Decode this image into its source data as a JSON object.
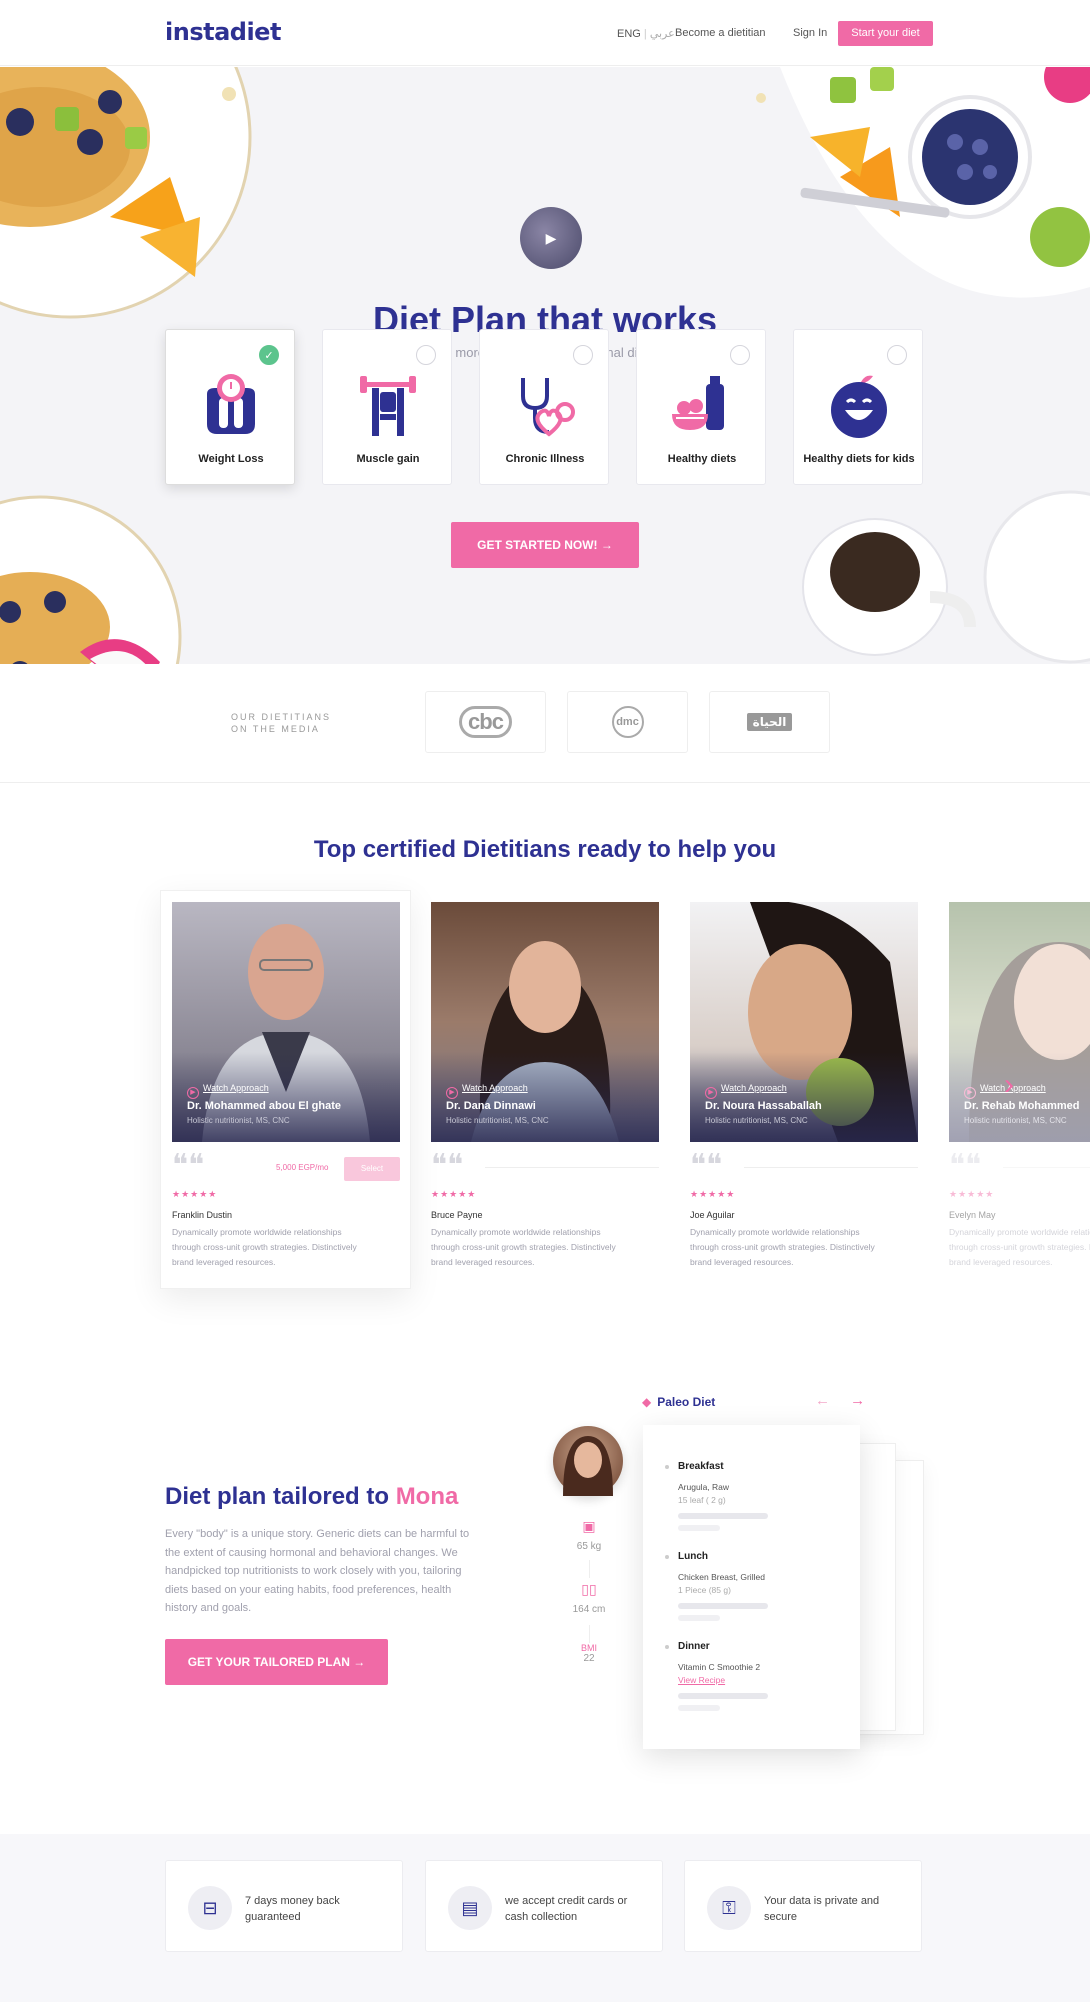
{
  "header": {
    "logo": "instadiet",
    "lang_en": "ENG",
    "lang_sep": "|",
    "lang_ar": "عربي",
    "become_dietitian": "Become a dietitian",
    "sign_in": "Sign In",
    "start_button": "Start your diet"
  },
  "hero": {
    "play_icon": "play-icon",
    "title": "Diet Plan that works",
    "subtitle": "Pick one goal or more and let our professional dietitians help you",
    "goals": [
      {
        "label": "Weight Loss",
        "selected": true,
        "icon": "scale-icon"
      },
      {
        "label": "Muscle gain",
        "selected": false,
        "icon": "weight-bench-icon"
      },
      {
        "label": "Chronic Illness",
        "selected": false,
        "icon": "stethoscope-icon"
      },
      {
        "label": "Healthy diets",
        "selected": false,
        "icon": "fruit-bowl-icon"
      },
      {
        "label": "Healthy diets for kids",
        "selected": false,
        "icon": "apple-icon"
      }
    ],
    "cta": "GET STARTED NOW!",
    "cta_arrow": "→"
  },
  "media": {
    "label": "OUR DIETITIANS ON THE MEDIA",
    "logos": [
      "cbc",
      "dmc",
      "الحياة"
    ]
  },
  "dietitians": {
    "title": "Top certified Dietitians ready to help you",
    "watch_label": "Watch Approach",
    "cards": [
      {
        "name": "Dr. Mohammed abou El ghate",
        "title": "Holistic nutritionist, MS, CNC",
        "price": "5,000 EGP/mo",
        "select": "Select",
        "stars": "★★★★★",
        "reviewer": "Franklin Dustin",
        "review": "Dynamically promote worldwide relationships through cross-unit growth strategies. Distinctively brand leveraged resources."
      },
      {
        "name": "Dr. Dana Dinnawi",
        "title": "Holistic nutritionist, MS, CNC",
        "stars": "★★★★★",
        "reviewer": "Bruce Payne",
        "review": "Dynamically promote worldwide relationships through cross-unit growth strategies. Distinctively brand leveraged resources."
      },
      {
        "name": "Dr. Noura Hassaballah",
        "title": "Holistic nutritionist, MS, CNC",
        "stars": "★★★★★",
        "reviewer": "Joe Aguilar",
        "review": "Dynamically promote worldwide relationships through cross-unit growth strategies. Distinctively brand leveraged resources."
      },
      {
        "name": "Dr. Rehab Mohammed",
        "title": "Holistic nutritionist, MS, CNC",
        "stars": "★★★★★",
        "reviewer": "Evelyn May",
        "review": "Dynamically promote worldwide relationships through cross-unit growth strategies. Distinctively brand leveraged resources."
      }
    ],
    "next_arrow": "›"
  },
  "tailored": {
    "title_prefix": "Diet plan tailored to ",
    "title_name": "Mona",
    "text": "Every \"body\" is a unique story. Generic diets can be harmful to the extent of causing hormonal and behavioral changes. We handpicked top nutritionists to work closely with you, tailoring diets based on your eating habits, food preferences, health history and goals.",
    "cta": "GET YOUR TAILORED PLAN",
    "cta_arrow": "→",
    "weight": "65 kg",
    "height": "164 cm",
    "bmi_label": "BMI",
    "bmi": "22",
    "diet_name": "Paleo Diet",
    "prev_arrow": "←",
    "next_arrow": "→",
    "meals": [
      {
        "name": "Breakfast",
        "item": "Arugula, Raw",
        "qty": "15 leaf ( 2 g)"
      },
      {
        "name": "Lunch",
        "item": "Chicken Breast, Grilled",
        "qty": "1 Piece (85 g)"
      },
      {
        "name": "Dinner",
        "item": "Vitamin C Smoothie 2",
        "link": "View Recipe"
      }
    ]
  },
  "features": [
    {
      "text": "7 days money back guaranteed",
      "icon": "money-back-icon"
    },
    {
      "text": "we accept credit cards or cash collection",
      "icon": "credit-card-icon"
    },
    {
      "text": "Your data is private and secure",
      "icon": "lock-user-icon"
    }
  ],
  "colors": {
    "primary": "#2e3192",
    "accent": "#f06aa6",
    "check": "#5cc48d",
    "hero_bg": "#f4f4f7"
  }
}
